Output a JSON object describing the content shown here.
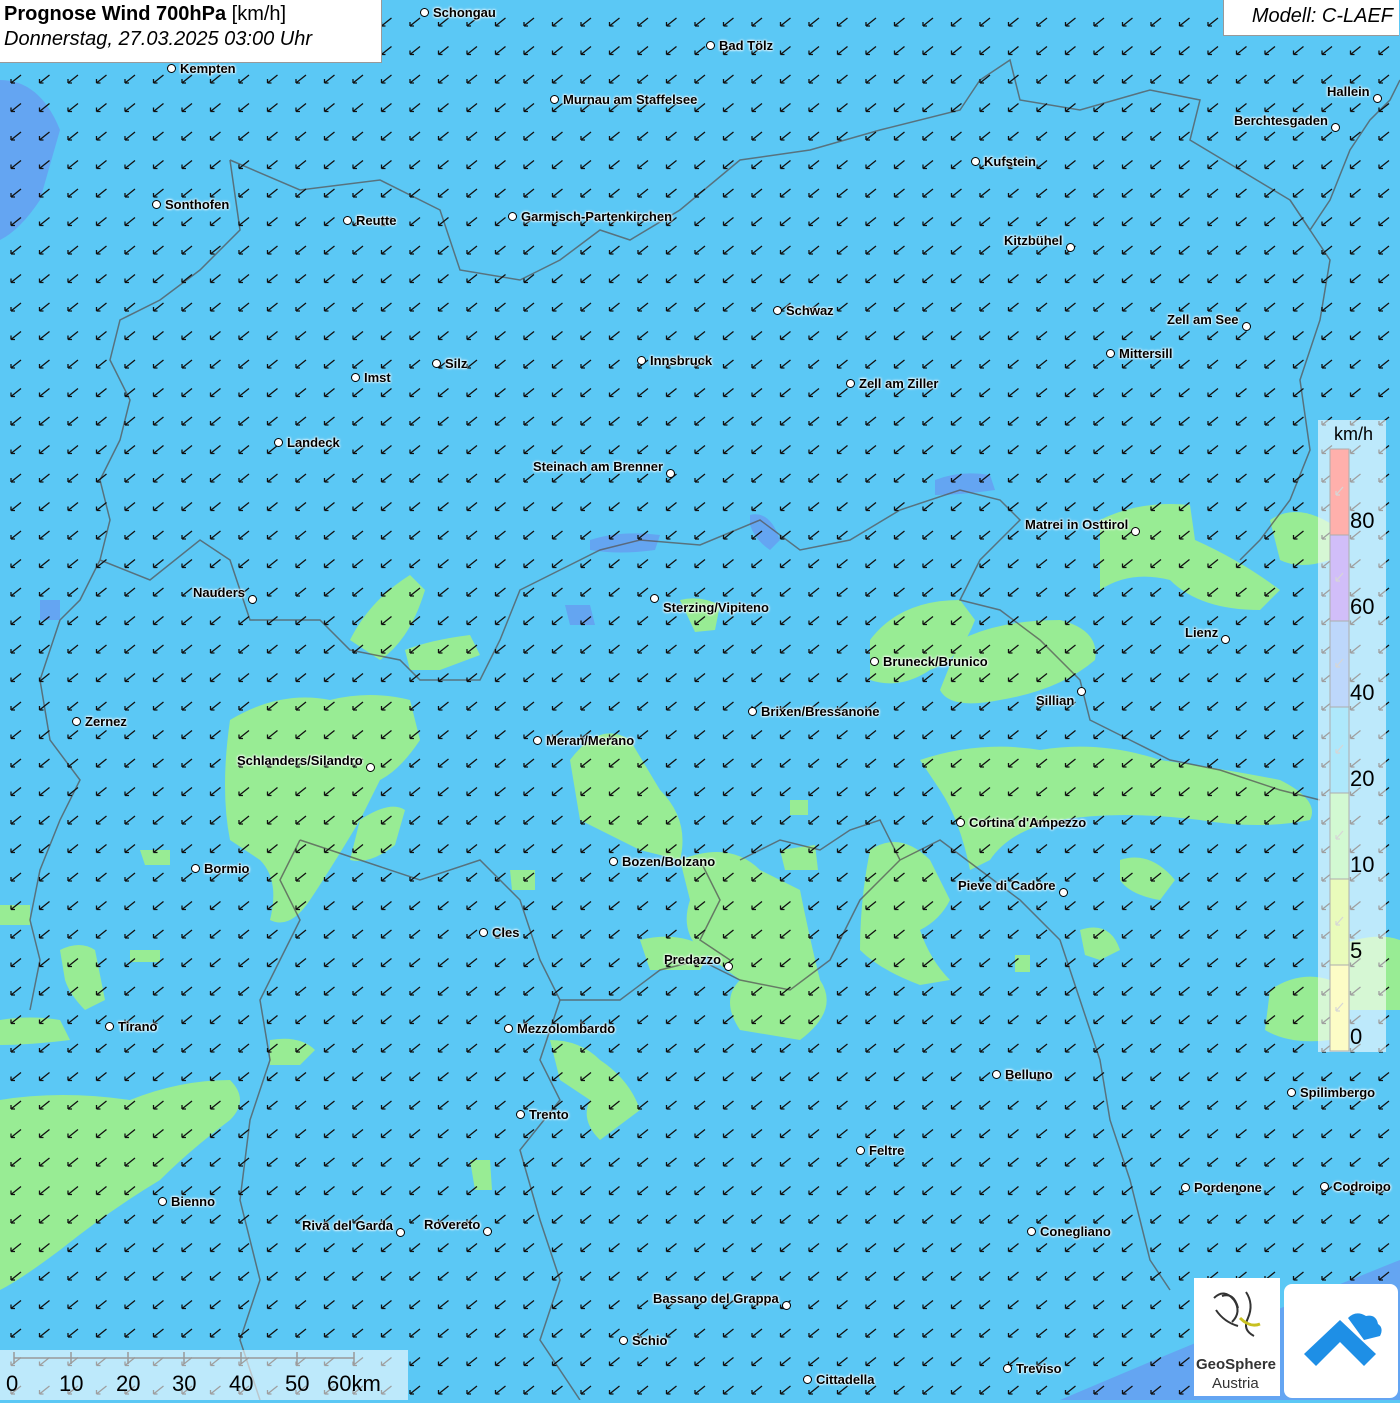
{
  "header": {
    "title_bold": "Prognose Wind 700hPa",
    "title_unit": "[km/h]",
    "datetime": "Donnerstag, 27.03.2025 03:00 Uhr",
    "model": "Modell: C-LAEF"
  },
  "legend": {
    "unit": "km/h",
    "labels": [
      "80",
      "60",
      "40",
      "20",
      "10",
      "5",
      "0"
    ],
    "colors": [
      "#ff3b30",
      "#8c5cf0",
      "#5a9cf5",
      "#36c6f4",
      "#8ff08f",
      "#c8f555",
      "#f8f870"
    ]
  },
  "scalebar": {
    "labels": [
      "0",
      "10",
      "20",
      "30",
      "40",
      "50",
      "60km"
    ]
  },
  "cities": [
    {
      "name": "Schongau"
    },
    {
      "name": "Bad Tölz"
    },
    {
      "name": "Kempten"
    },
    {
      "name": "Murnau am Staffelsee"
    },
    {
      "name": "Hallein"
    },
    {
      "name": "Berchtesgaden"
    },
    {
      "name": "Kufstein"
    },
    {
      "name": "Sonthofen"
    },
    {
      "name": "Reutte"
    },
    {
      "name": "Garmisch-Partenkirchen"
    },
    {
      "name": "Kitzbühel"
    },
    {
      "name": "Schwaz"
    },
    {
      "name": "Zell am See"
    },
    {
      "name": "Mittersill"
    },
    {
      "name": "Innsbruck"
    },
    {
      "name": "Silz"
    },
    {
      "name": "Imst"
    },
    {
      "name": "Zell am Ziller"
    },
    {
      "name": "Landeck"
    },
    {
      "name": "Steinach am Brenner"
    },
    {
      "name": "Matrei in Osttirol"
    },
    {
      "name": "Nauders"
    },
    {
      "name": "Sterzing/Vipiteno"
    },
    {
      "name": "Lienz"
    },
    {
      "name": "Bruneck/Brunico"
    },
    {
      "name": "Sillian"
    },
    {
      "name": "Zernez"
    },
    {
      "name": "Brixen/Bressanone"
    },
    {
      "name": "Meran/Merano"
    },
    {
      "name": "Schlanders/Silandro"
    },
    {
      "name": "Cortina d'Ampezzo"
    },
    {
      "name": "Bozen/Bolzano"
    },
    {
      "name": "Bormio"
    },
    {
      "name": "Pieve di Cadore"
    },
    {
      "name": "Cles"
    },
    {
      "name": "Predazzo"
    },
    {
      "name": "Tirano"
    },
    {
      "name": "Mezzolombardo"
    },
    {
      "name": "Belluno"
    },
    {
      "name": "Spilimbergo"
    },
    {
      "name": "Trento"
    },
    {
      "name": "Feltre"
    },
    {
      "name": "Pordenone"
    },
    {
      "name": "Codroipo"
    },
    {
      "name": "Bienno"
    },
    {
      "name": "Riva del Garda"
    },
    {
      "name": "Rovereto"
    },
    {
      "name": "Conegliano"
    },
    {
      "name": "Bassano del Grappa"
    },
    {
      "name": "Schio"
    },
    {
      "name": "Treviso"
    },
    {
      "name": "Cittadella"
    }
  ],
  "logo": {
    "name_line1": "GeoSphere",
    "name_line2": "Austria"
  }
}
